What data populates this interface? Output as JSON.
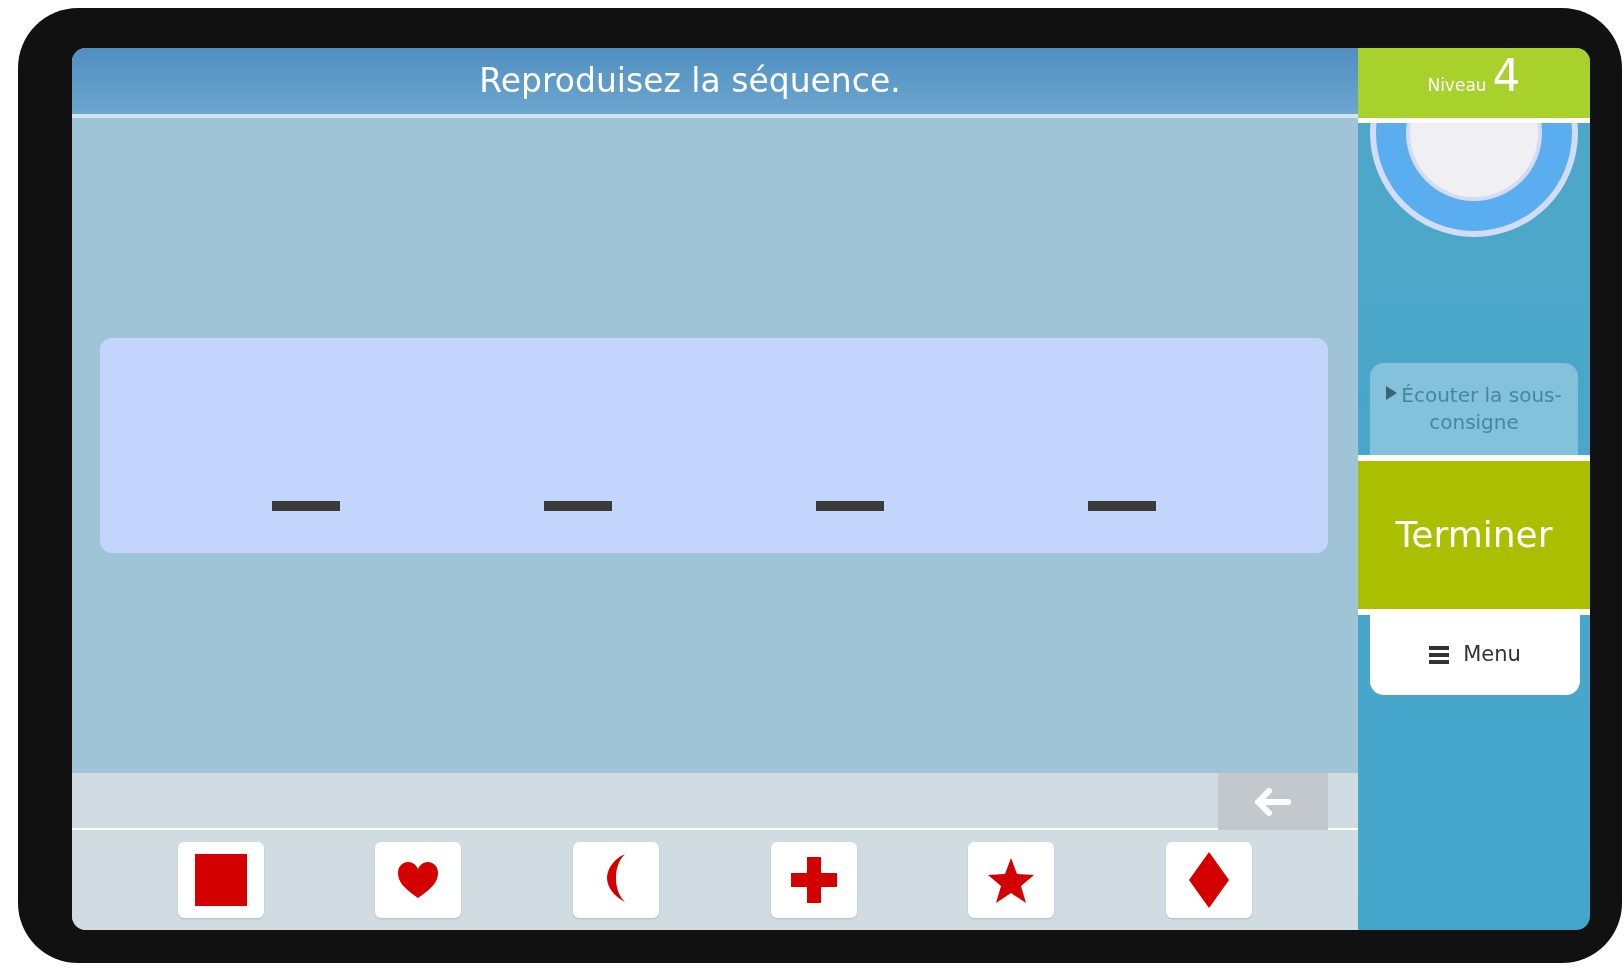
{
  "header": {
    "title": "Reproduisez la séquence."
  },
  "level": {
    "label": "Niveau",
    "value": "4"
  },
  "slots": [
    {
      "kind": "empty"
    },
    {
      "kind": "empty"
    },
    {
      "kind": "empty"
    },
    {
      "kind": "empty"
    }
  ],
  "symbols": [
    {
      "kind": "square"
    },
    {
      "kind": "heart"
    },
    {
      "kind": "crescent"
    },
    {
      "kind": "cross"
    },
    {
      "kind": "star"
    },
    {
      "kind": "diamond"
    }
  ],
  "listen_button": {
    "label": "Écouter la sous-consigne",
    "disabled": true
  },
  "finish_button": {
    "label": "Terminer"
  },
  "menu_button": {
    "label": "Menu"
  }
}
